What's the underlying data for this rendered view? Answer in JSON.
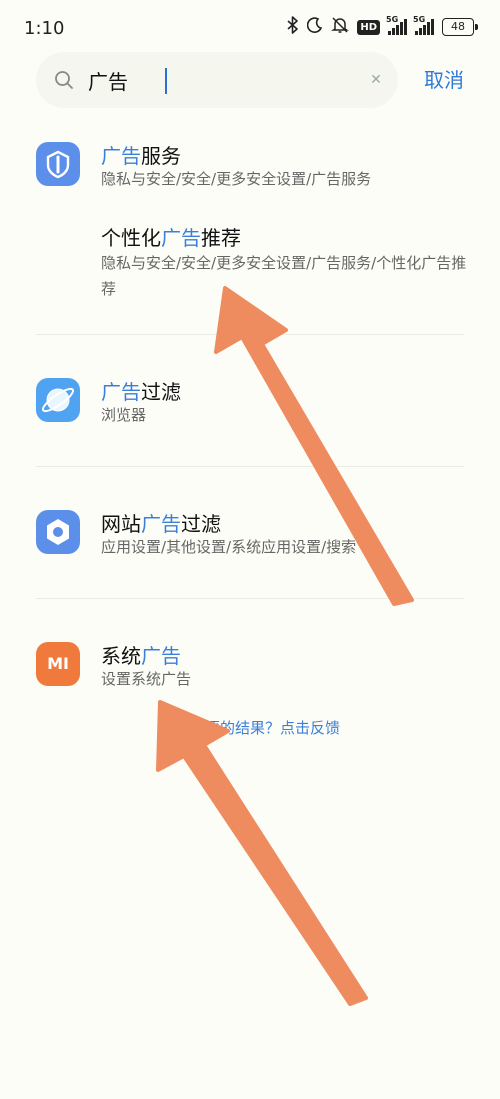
{
  "status_bar": {
    "time": "1:10",
    "hd_badge": "HD",
    "network_1": "5G",
    "network_2": "5G",
    "battery": "48"
  },
  "search": {
    "query": "广告",
    "placeholder": "",
    "cancel_label": "取消"
  },
  "results": [
    {
      "title_highlight": "广告",
      "title_rest": "服务",
      "path": "隐私与安全/安全/更多安全设置/广告服务",
      "icon": "shield-icon",
      "icon_color": "#5b8fea"
    },
    {
      "title_prefix": "个性化",
      "title_highlight": "广告",
      "title_rest": "推荐",
      "path": "隐私与安全/安全/更多安全设置/广告服务/个性化广告推荐"
    },
    {
      "title_highlight": "广告",
      "title_rest": "过滤",
      "path": "浏览器",
      "icon": "browser-planet-icon",
      "icon_color": "#4fa3f0"
    },
    {
      "title_prefix": "网站",
      "title_highlight": "广告",
      "title_rest": "过滤",
      "path": "应用设置/其他设置/系统应用设置/搜索",
      "icon": "settings-hexagon-icon",
      "icon_color": "#5b8fea"
    },
    {
      "title_prefix": "系统",
      "title_highlight": "广告",
      "title_rest": "",
      "path": "设置系统广告",
      "icon": "mi-logo-icon",
      "icon_color": "#f07a3c",
      "icon_text": "MI"
    }
  ],
  "feedback": "没有想要的结果？点击反馈",
  "colors": {
    "accent": "#3a7fd9",
    "annotation_arrow": "#ee8b5f"
  }
}
